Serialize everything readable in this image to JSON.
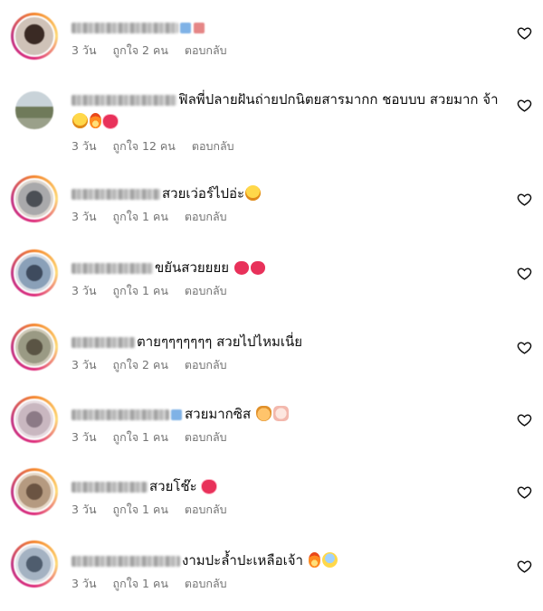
{
  "colors": {
    "text": "#0c0c0c",
    "meta": "#737373",
    "background": "#ffffff"
  },
  "comments": [
    {
      "username": "",
      "text": "",
      "time": "3 วัน",
      "likes": "ถูกใจ 2 คน",
      "reply": "ตอบกลับ",
      "icons": [
        "verified-blue-icon",
        "heart-red-icon"
      ]
    },
    {
      "username": "",
      "text": "ฟิลพี่ปลายฝันถ่ายปกนิตยสารมากก ชอบบบ สวยมาก จ้า",
      "time": "3 วัน",
      "likes": "ถูกใจ 12 คน",
      "reply": "ตอบกลับ",
      "icons": [
        "heart-eyes-emoji",
        "fire-emoji",
        "sparkling-heart-emoji"
      ]
    },
    {
      "username": "",
      "text": "สวยเว่อร์ไปอ่ะ",
      "time": "3 วัน",
      "likes": "ถูกใจ 1 คน",
      "reply": "ตอบกลับ",
      "icons": [
        "heart-eyes-emoji"
      ]
    },
    {
      "username": "",
      "text": "ขยันสวยยยย",
      "time": "3 วัน",
      "likes": "ถูกใจ 1 คน",
      "reply": "ตอบกลับ",
      "icons": [
        "heart-emoji",
        "heart-emoji"
      ]
    },
    {
      "username": "",
      "text": "ตายๆๆๆๆๆๆๆ สวยไปไหมเนี่ย",
      "time": "3 วัน",
      "likes": "ถูกใจ 2 คน",
      "reply": "ตอบกลับ",
      "icons": []
    },
    {
      "username": "",
      "text": "สวยมากซิส",
      "time": "3 วัน",
      "likes": "ถูกใจ 1 คน",
      "reply": "ตอบกลับ",
      "icons": [
        "verified-blue-icon",
        "cat-emoji",
        "heart-hands-emoji"
      ]
    },
    {
      "username": "",
      "text": "สวยโช๊ะ",
      "time": "3 วัน",
      "likes": "ถูกใจ 1 คน",
      "reply": "ตอบกลับ",
      "icons": [
        "sparkling-heart-emoji"
      ]
    },
    {
      "username": "",
      "text": "งามปะล้ำปะเหลือเจ้า",
      "time": "3 วัน",
      "likes": "ถูกใจ 1 คน",
      "reply": "ตอบกลับ",
      "icons": [
        "fire-emoji",
        "scream-emoji"
      ]
    }
  ]
}
